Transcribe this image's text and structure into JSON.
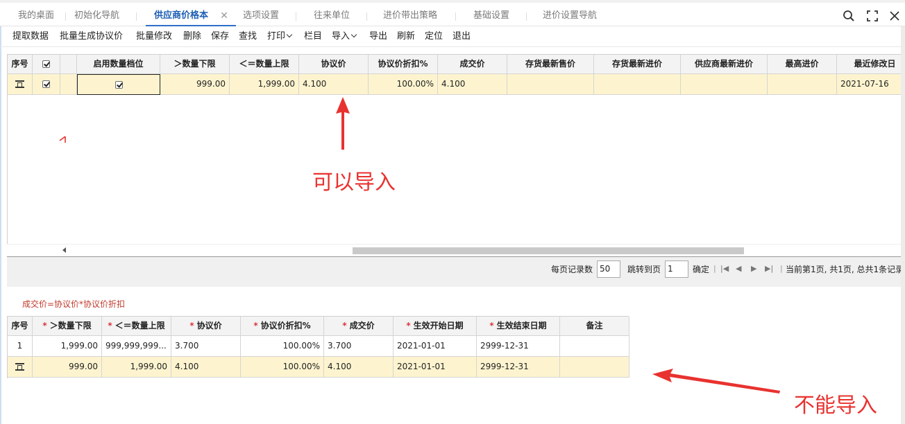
{
  "tabs": [
    {
      "label": "我的桌面",
      "active": false
    },
    {
      "label": "初始化导航",
      "active": false
    },
    {
      "label": "供应商价格本",
      "active": true
    },
    {
      "label": "选项设置",
      "active": false
    },
    {
      "label": "往来单位",
      "active": false
    },
    {
      "label": "进价带出策略",
      "active": false
    },
    {
      "label": "基础设置",
      "active": false
    },
    {
      "label": "进价设置导航",
      "active": false
    }
  ],
  "window_icons": [
    "search-icon",
    "fullscreen-icon",
    "close-icon"
  ],
  "toolbar": {
    "fetch": "提取数据",
    "batch_generate": "批量生成协议价",
    "batch_modify": "批量修改",
    "delete": "删除",
    "save": "保存",
    "find": "查找",
    "print": "打印",
    "columns": "栏目",
    "import": "导入",
    "export": "导出",
    "refresh": "刷新",
    "locate": "定位",
    "exit": "退出"
  },
  "grid1": {
    "headers": [
      "序号",
      "",
      "",
      "启用数量档位",
      "＞数量下限",
      "＜＝数量上限",
      "协议价",
      "协议价折扣%",
      "成交价",
      "存货最新售价",
      "存货最新进价",
      "供应商最新进价",
      "最高进价",
      "最近修改日"
    ],
    "row": {
      "select_checked": true,
      "enabled_tier_checked": true,
      "qty_lower": "999.00",
      "qty_upper": "1,999.00",
      "agreed_price": "4.100",
      "discount_pct": "100.00%",
      "deal_price": "4.100",
      "stock_latest_sale": "",
      "stock_latest_purchase": "",
      "supplier_latest_purchase": "",
      "highest_purchase": "",
      "last_modified": "2021-07-16"
    }
  },
  "pager": {
    "page_size_label": "每页记录数",
    "page_size_value": "50",
    "jump_label": "跳转到页",
    "jump_value": "1",
    "confirm": "确定",
    "status": "当前第1页, 共1页, 总共1条记录"
  },
  "formula_note": "成交价=协议价*协议价折扣",
  "grid2": {
    "headers": [
      {
        "label": "序号",
        "required": false
      },
      {
        "label": "＞数量下限",
        "required": true
      },
      {
        "label": "＜＝数量上限",
        "required": true
      },
      {
        "label": "协议价",
        "required": true
      },
      {
        "label": "协议价折扣%",
        "required": true
      },
      {
        "label": "成交价",
        "required": true
      },
      {
        "label": "生效开始日期",
        "required": true
      },
      {
        "label": "生效结束日期",
        "required": true
      },
      {
        "label": "备注",
        "required": false
      }
    ],
    "rows": [
      {
        "seq": "1",
        "qty_lower": "1,999.00",
        "qty_upper": "999,999,999...",
        "agreed_price": "3.700",
        "discount_pct": "100.00%",
        "deal_price": "3.700",
        "start": "2021-01-01",
        "end": "2999-12-31",
        "note": ""
      },
      {
        "seq": "",
        "qty_lower": "999.00",
        "qty_upper": "1,999.00",
        "agreed_price": "4.100",
        "discount_pct": "100.00%",
        "deal_price": "4.100",
        "start": "2021-01-01",
        "end": "2999-12-31",
        "note": ""
      }
    ]
  },
  "annotations": {
    "can_import": "可以导入",
    "cannot_import": "不能导入",
    "color": "#e8322f"
  }
}
